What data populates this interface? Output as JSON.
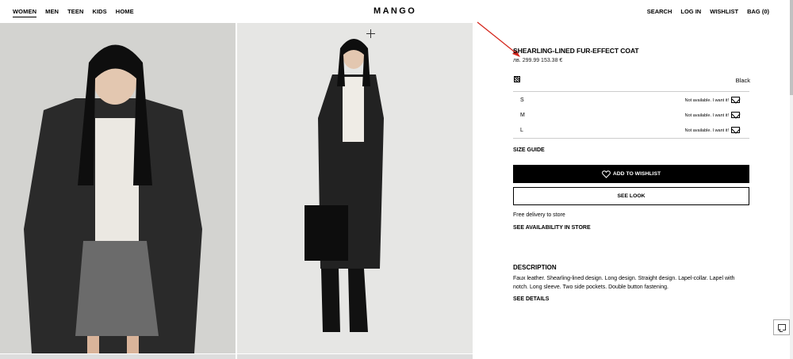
{
  "header": {
    "nav_left": [
      "WOMEN",
      "MEN",
      "TEEN",
      "KIDS",
      "HOME"
    ],
    "logo": "MANGO",
    "nav_right": [
      "SEARCH",
      "LOG IN",
      "WISHLIST",
      "BAG (0)"
    ]
  },
  "product": {
    "title": "SHEARLING-LINED FUR-EFFECT COAT",
    "price": "лв. 299.99  153.38 €",
    "color": "Black",
    "sizes": [
      {
        "size": "S",
        "status": "Not available. I want it!"
      },
      {
        "size": "M",
        "status": "Not available. I want it!"
      },
      {
        "size": "L",
        "status": "Not available. I want it!"
      }
    ],
    "size_guide": "SIZE GUIDE",
    "add_to_wishlist": "ADD TO WISHLIST",
    "see_look": "SEE LOOK",
    "delivery": "Free delivery to store",
    "availability": "SEE AVAILABILITY IN STORE",
    "description_title": "DESCRIPTION",
    "description": "Faux leather. Shearling-lined design. Long design. Straight design. Lapel-collar. Lapel with notch. Long sleeve. Two side pockets. Double button fastening.",
    "see_details": "SEE DETAILS"
  },
  "icons": {
    "zoom": "plus-icon",
    "heart": "heart-icon",
    "notify": "envelope-icon",
    "chat": "chat-icon",
    "swatch": "color-swatch"
  },
  "colors": {
    "accent_red": "#d4261c",
    "button": "#000000"
  }
}
